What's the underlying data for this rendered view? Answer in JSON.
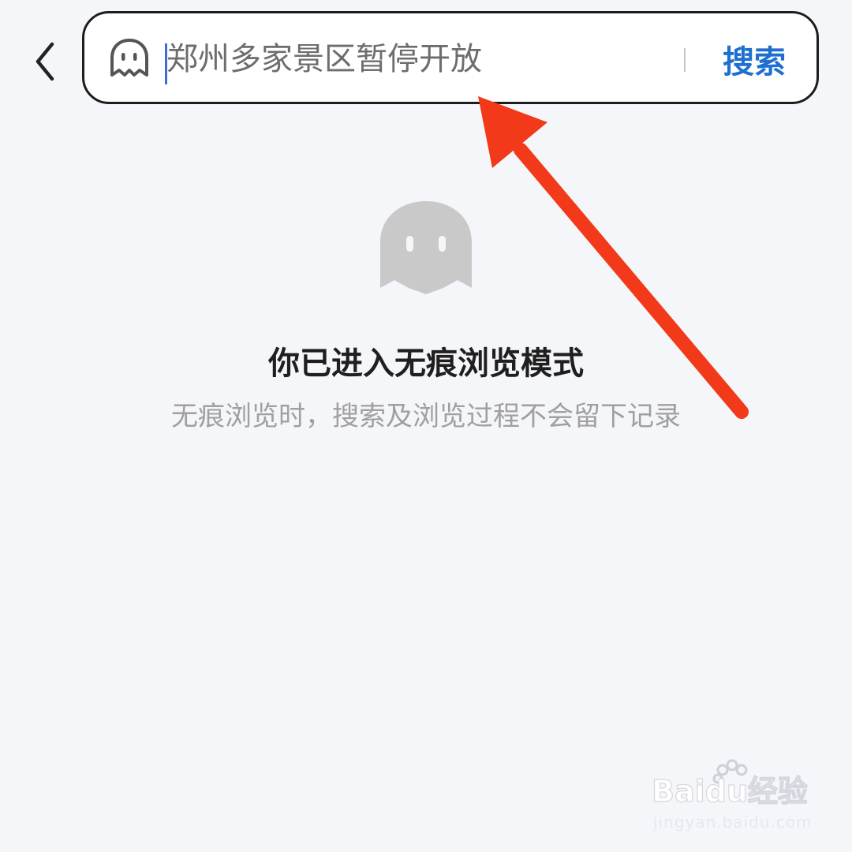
{
  "header": {
    "back_icon": "chevron-left-icon",
    "search": {
      "icon": "ghost-icon",
      "placeholder": "郑州多家景区暂停开放",
      "value": "",
      "button_label": "搜索"
    }
  },
  "empty_state": {
    "icon": "ghost-icon",
    "title": "你已进入无痕浏览模式",
    "description": "无痕浏览时，搜索及浏览过程不会留下记录"
  },
  "annotation": {
    "icon": "red-arrow-icon"
  },
  "watermark": {
    "logo_text": "Baidu经验",
    "url": "jingyan.baidu.com"
  },
  "colors": {
    "background": "#f5f6fa",
    "accent_blue": "#1f6fd1",
    "arrow_red": "#f23a1a",
    "ghost_gray": "#c9c9c9"
  }
}
